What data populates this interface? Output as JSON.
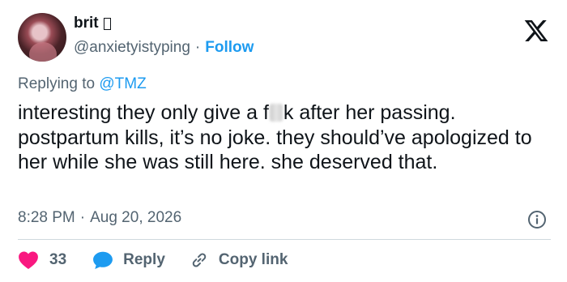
{
  "user": {
    "name": "brit",
    "handle": "@anxietyistyping",
    "follow_label": "Follow",
    "separator": "·"
  },
  "reply": {
    "prefix": "Replying to",
    "mention": "@TMZ"
  },
  "tweet": {
    "text_part1": "interesting they only give a f",
    "text_part2": "k after her passing. postpartum kills, it’s no joke. they should’ve apologized to her while she was still here. she deserved that."
  },
  "meta": {
    "time": "8:28 PM",
    "separator": "·",
    "date": "Aug 20, 2026"
  },
  "actions": {
    "likes_count": "33",
    "reply_label": "Reply",
    "copy_link_label": "Copy link"
  },
  "colors": {
    "link": "#1d9bf0",
    "heart": "#f91880",
    "muted": "#536471",
    "text": "#0f1419"
  },
  "icons": [
    "x-logo-icon",
    "info-icon",
    "heart-icon",
    "reply-bubble-icon",
    "link-icon"
  ]
}
